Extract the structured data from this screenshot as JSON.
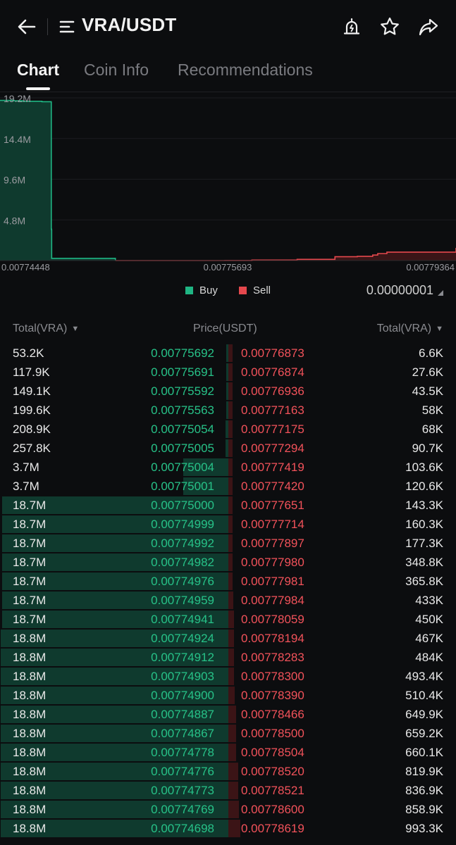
{
  "header": {
    "pair": "VRA/USDT",
    "back_icon": "arrow-left-icon",
    "menu_icon": "menu-lines-icon",
    "alert_icon": "price-alert-icon",
    "favorite_icon": "star-icon",
    "share_icon": "share-icon"
  },
  "tabs": [
    {
      "label": "Chart",
      "active": true
    },
    {
      "label": "Coin Info",
      "active": false
    },
    {
      "label": "Recommendations",
      "active": false
    }
  ],
  "chart_data": {
    "type": "area",
    "y_ticks": [
      "19.2M",
      "14.4M",
      "9.6M",
      "4.8M"
    ],
    "x_ticks": [
      "0.00774448",
      "0.00775693",
      "0.00779364"
    ],
    "ylim": [
      0,
      19200000
    ],
    "series": [
      {
        "name": "Buy",
        "color": "#1fb583",
        "points": [
          [
            0.00774448,
            18900000
          ],
          [
            0.007746,
            18850000
          ],
          [
            0.00774698,
            18800000
          ],
          [
            0.007749,
            18750000
          ],
          [
            0.00775,
            18700000
          ],
          [
            0.00775001,
            3700000
          ],
          [
            0.00775004,
            3600000
          ],
          [
            0.00775005,
            257800
          ],
          [
            0.00775692,
            53200
          ]
        ]
      },
      {
        "name": "Sell",
        "color": "#e5484d",
        "points": [
          [
            0.00775693,
            0
          ],
          [
            0.00776873,
            6600
          ],
          [
            0.00777163,
            58000
          ],
          [
            0.00777651,
            143300
          ],
          [
            0.00778059,
            450000
          ],
          [
            0.007783,
            493400
          ],
          [
            0.00778466,
            649900
          ],
          [
            0.0077852,
            819900
          ],
          [
            0.00778619,
            993300
          ],
          [
            0.00779364,
            1500000
          ]
        ]
      }
    ],
    "legend": [
      "Buy",
      "Sell"
    ],
    "colors": {
      "buy": "#1fb583",
      "sell": "#e5484d",
      "grid": "#1c1d20",
      "axis_text": "#9a9ba0"
    }
  },
  "legend": {
    "buy": "Buy",
    "sell": "Sell"
  },
  "precision": "0.00000001",
  "orderbook": {
    "headers": {
      "buy_total": "Total(VRA)",
      "price": "Price(USDT)",
      "sell_total": "Total(VRA)"
    },
    "rows": [
      {
        "buy_total": "53.2K",
        "buy_price": "0.00775692",
        "sell_price": "0.00776873",
        "sell_total": "6.6K",
        "buy_depth": 0.0028,
        "sell_depth": 0.0066
      },
      {
        "buy_total": "117.9K",
        "buy_price": "0.00775691",
        "sell_price": "0.00776874",
        "sell_total": "27.6K",
        "buy_depth": 0.0063,
        "sell_depth": 0.0278
      },
      {
        "buy_total": "149.1K",
        "buy_price": "0.00775592",
        "sell_price": "0.00776936",
        "sell_total": "43.5K",
        "buy_depth": 0.0079,
        "sell_depth": 0.0438
      },
      {
        "buy_total": "199.6K",
        "buy_price": "0.00775563",
        "sell_price": "0.00777163",
        "sell_total": "58K",
        "buy_depth": 0.0106,
        "sell_depth": 0.0584
      },
      {
        "buy_total": "208.9K",
        "buy_price": "0.00775054",
        "sell_price": "0.00777175",
        "sell_total": "68K",
        "buy_depth": 0.0111,
        "sell_depth": 0.0685
      },
      {
        "buy_total": "257.8K",
        "buy_price": "0.00775005",
        "sell_price": "0.00777294",
        "sell_total": "90.7K",
        "buy_depth": 0.0137,
        "sell_depth": 0.0913
      },
      {
        "buy_total": "3.7M",
        "buy_price": "0.00775004",
        "sell_price": "0.00777419",
        "sell_total": "103.6K",
        "buy_depth": 0.197,
        "sell_depth": 0.1043
      },
      {
        "buy_total": "3.7M",
        "buy_price": "0.00775001",
        "sell_price": "0.00777420",
        "sell_total": "120.6K",
        "buy_depth": 0.197,
        "sell_depth": 0.1214
      },
      {
        "buy_total": "18.7M",
        "buy_price": "0.00775000",
        "sell_price": "0.00777651",
        "sell_total": "143.3K",
        "buy_depth": 0.995,
        "sell_depth": 0.1443
      },
      {
        "buy_total": "18.7M",
        "buy_price": "0.00774999",
        "sell_price": "0.00777714",
        "sell_total": "160.3K",
        "buy_depth": 0.995,
        "sell_depth": 0.1614
      },
      {
        "buy_total": "18.7M",
        "buy_price": "0.00774992",
        "sell_price": "0.00777897",
        "sell_total": "177.3K",
        "buy_depth": 0.995,
        "sell_depth": 0.1785
      },
      {
        "buy_total": "18.7M",
        "buy_price": "0.00774982",
        "sell_price": "0.00777980",
        "sell_total": "348.8K",
        "buy_depth": 0.995,
        "sell_depth": 0.3511
      },
      {
        "buy_total": "18.7M",
        "buy_price": "0.00774976",
        "sell_price": "0.00777981",
        "sell_total": "365.8K",
        "buy_depth": 0.995,
        "sell_depth": 0.3683
      },
      {
        "buy_total": "18.7M",
        "buy_price": "0.00774959",
        "sell_price": "0.00777984",
        "sell_total": "433K",
        "buy_depth": 0.995,
        "sell_depth": 0.4359
      },
      {
        "buy_total": "18.7M",
        "buy_price": "0.00774941",
        "sell_price": "0.00778059",
        "sell_total": "450K",
        "buy_depth": 0.995,
        "sell_depth": 0.453
      },
      {
        "buy_total": "18.8M",
        "buy_price": "0.00774924",
        "sell_price": "0.00778194",
        "sell_total": "467K",
        "buy_depth": 1.0,
        "sell_depth": 0.4701
      },
      {
        "buy_total": "18.8M",
        "buy_price": "0.00774912",
        "sell_price": "0.00778283",
        "sell_total": "484K",
        "buy_depth": 1.0,
        "sell_depth": 0.4873
      },
      {
        "buy_total": "18.8M",
        "buy_price": "0.00774903",
        "sell_price": "0.00778300",
        "sell_total": "493.4K",
        "buy_depth": 1.0,
        "sell_depth": 0.4967
      },
      {
        "buy_total": "18.8M",
        "buy_price": "0.00774900",
        "sell_price": "0.00778390",
        "sell_total": "510.4K",
        "buy_depth": 1.0,
        "sell_depth": 0.5138
      },
      {
        "buy_total": "18.8M",
        "buy_price": "0.00774887",
        "sell_price": "0.00778466",
        "sell_total": "649.9K",
        "buy_depth": 1.0,
        "sell_depth": 0.6543
      },
      {
        "buy_total": "18.8M",
        "buy_price": "0.00774867",
        "sell_price": "0.00778500",
        "sell_total": "659.2K",
        "buy_depth": 1.0,
        "sell_depth": 0.6636
      },
      {
        "buy_total": "18.8M",
        "buy_price": "0.00774778",
        "sell_price": "0.00778504",
        "sell_total": "660.1K",
        "buy_depth": 1.0,
        "sell_depth": 0.6645
      },
      {
        "buy_total": "18.8M",
        "buy_price": "0.00774776",
        "sell_price": "0.00778520",
        "sell_total": "819.9K",
        "buy_depth": 1.0,
        "sell_depth": 0.8254
      },
      {
        "buy_total": "18.8M",
        "buy_price": "0.00774773",
        "sell_price": "0.00778521",
        "sell_total": "836.9K",
        "buy_depth": 1.0,
        "sell_depth": 0.8425
      },
      {
        "buy_total": "18.8M",
        "buy_price": "0.00774769",
        "sell_price": "0.00778600",
        "sell_total": "858.9K",
        "buy_depth": 1.0,
        "sell_depth": 0.8647
      },
      {
        "buy_total": "18.8M",
        "buy_price": "0.00774698",
        "sell_price": "0.00778619",
        "sell_total": "993.3K",
        "buy_depth": 1.0,
        "sell_depth": 1.0
      }
    ]
  }
}
